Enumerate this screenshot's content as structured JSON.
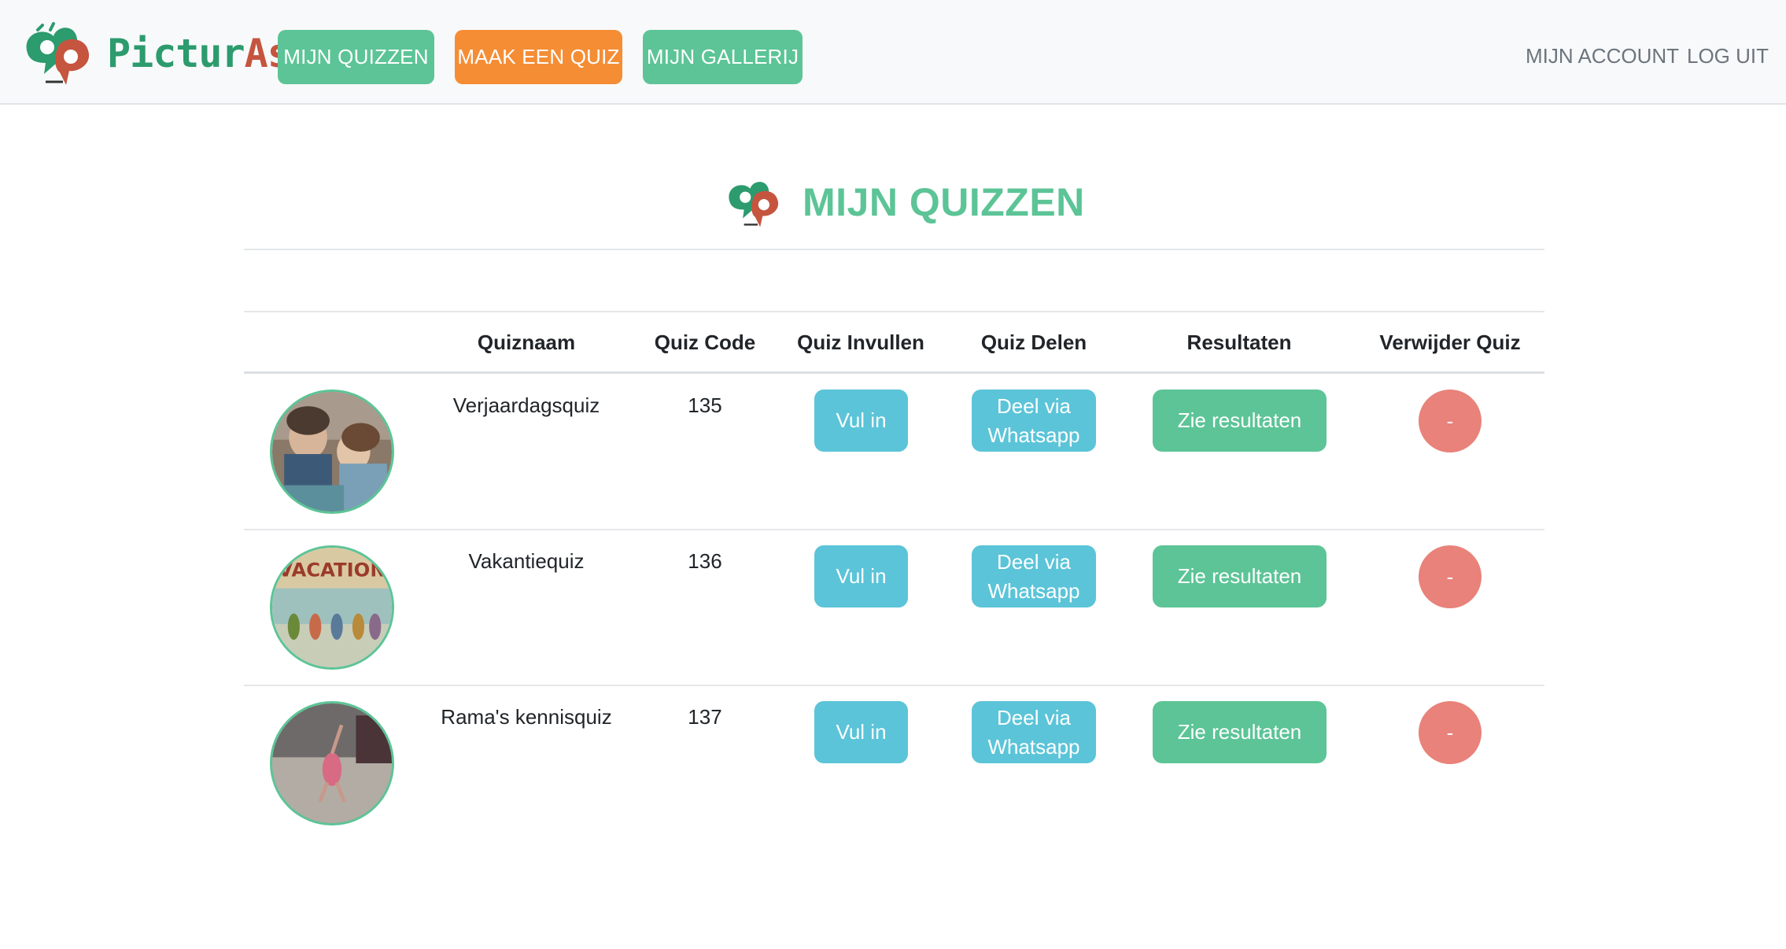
{
  "brand": {
    "name_part1": "Pictur",
    "name_part2": "Ask"
  },
  "nav": {
    "items": [
      {
        "label": "MIJN QUIZZEN"
      },
      {
        "label": "MAAK EEN QUIZ"
      },
      {
        "label": "MIJN GALLERIJ"
      }
    ],
    "account_label": "MIJN ACCOUNT",
    "logout_label": "LOG UIT"
  },
  "page": {
    "title": "MIJN QUIZZEN"
  },
  "table": {
    "headers": [
      "Quiznaam",
      "Quiz Code",
      "Quiz Invullen",
      "Quiz Delen",
      "Resultaten",
      "Verwijder Quiz"
    ],
    "rows": [
      {
        "name": "Verjaardagsquiz",
        "code": "135",
        "fill_label": "Vul in",
        "share_label_1": "Deel via",
        "share_label_2": "Whatsapp",
        "results_label": "Zie resultaten",
        "delete_label": "-"
      },
      {
        "name": "Vakantiequiz",
        "code": "136",
        "fill_label": "Vul in",
        "share_label_1": "Deel via",
        "share_label_2": "Whatsapp",
        "results_label": "Zie resultaten",
        "delete_label": "-"
      },
      {
        "name": "Rama's kennisquiz",
        "code": "137",
        "fill_label": "Vul in",
        "share_label_1": "Deel via",
        "share_label_2": "Whatsapp",
        "results_label": "Zie resultaten",
        "delete_label": "-"
      }
    ]
  },
  "colors": {
    "green": "#5cc496",
    "orange": "#f58d35",
    "cyan": "#5bc4d8",
    "red": "#e8827a",
    "logo_green": "#2c9b6e",
    "logo_red": "#c5553e"
  },
  "icons": {
    "logo": "picturask-logo-icon"
  }
}
